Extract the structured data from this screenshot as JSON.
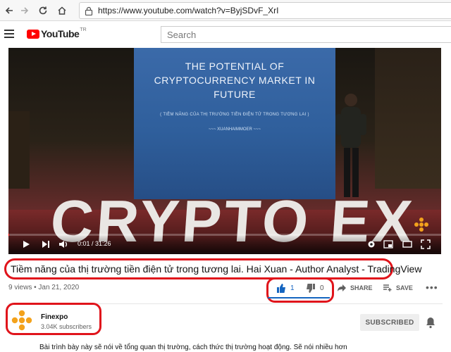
{
  "browser": {
    "url": "https://www.youtube.com/watch?v=ByjSDvF_XrI"
  },
  "header": {
    "logo_text": "YouTube",
    "logo_tr": "TR",
    "search_placeholder": "Search"
  },
  "player": {
    "slide_line1": "THE POTENTIAL OF",
    "slide_line2": "CRYPTOCURRENCY MARKET IN",
    "slide_line3": "FUTURE",
    "slide_subtitle": "( TIỀM NĂNG CỦA THỊ TRƯỜNG TIỀN ĐIỆN TỬ TRONG TƯƠNG LAI )",
    "slide_author": "~~~ XUANHAIMMOER ~~~",
    "banner_text": "CRYPTO EX",
    "time_current": "0:01",
    "time_total": "31:26",
    "time_display": "0:01 / 31:26",
    "progress": 0.0005
  },
  "video": {
    "title": "Tiềm năng của thị trường tiền điện tử trong tương lai. Hai Xuan - Author Analyst - TradingView",
    "views": "9 views",
    "date": "Jan 21, 2020",
    "meta": "9 views • Jan 21, 2020",
    "likes": "1",
    "dislikes": "0",
    "share_label": "SHARE",
    "save_label": "SAVE"
  },
  "channel": {
    "name": "Finexpo",
    "subscribers": "3.04K subscribers",
    "subscribe_label": "SUBSCRIBED"
  },
  "description": {
    "text": "Bài trình bày này sẽ nói về tổng quan thị trường, cách thức thị trường hoạt động. Sẽ nói nhiều hơn"
  },
  "colors": {
    "highlight_red": "#e0141b",
    "youtube_red": "#ff0000",
    "like_blue": "#1565c0"
  }
}
